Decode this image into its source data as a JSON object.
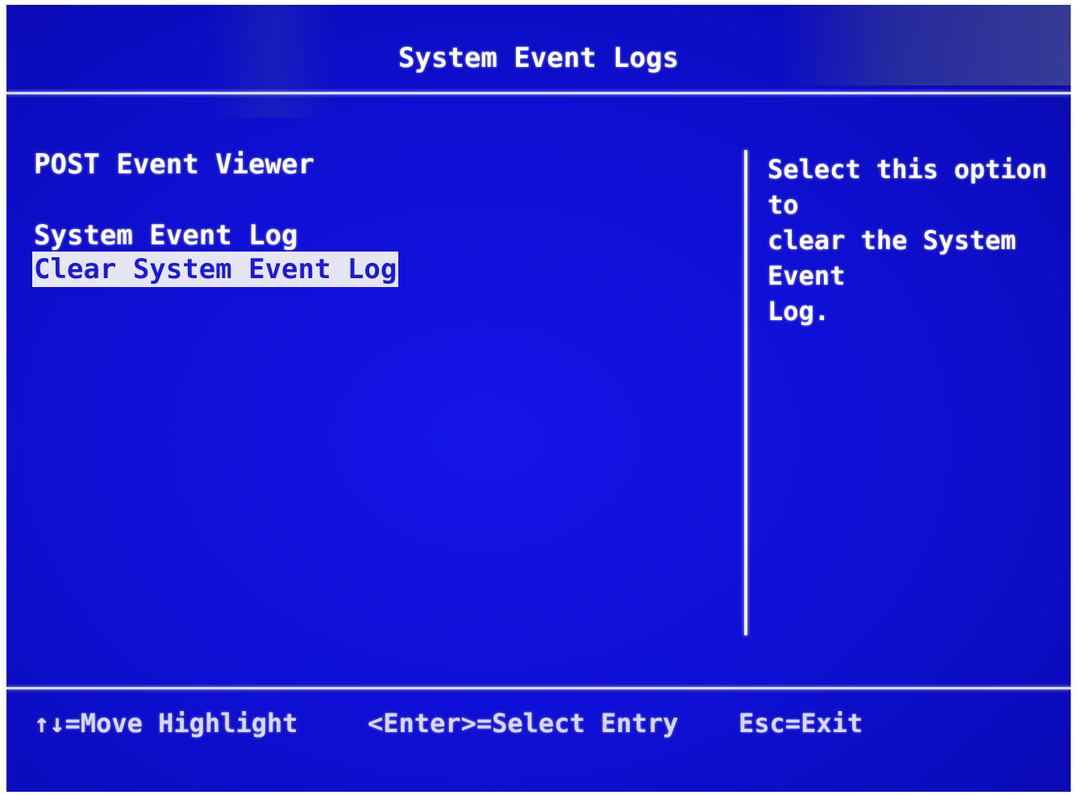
{
  "header": {
    "title": "System Event Logs"
  },
  "menu": {
    "items": [
      {
        "label": "POST Event Viewer"
      },
      {
        "label": "System Event Log"
      },
      {
        "label": "Clear System Event Log",
        "selected": true
      }
    ]
  },
  "help": {
    "text": "Select this option to\nclear the System Event\nLog."
  },
  "footer": {
    "move_icon": "up-down-arrows-icon",
    "move_arrows": "↑↓",
    "move_label": "=Move Highlight",
    "enter_label": "<Enter>=Select Entry",
    "esc_label": "Esc=Exit"
  },
  "colors": {
    "background": "#0f10d6",
    "text": "#ffffff",
    "highlight_bg": "#e6e6f2",
    "highlight_text": "#1a1ad8"
  }
}
